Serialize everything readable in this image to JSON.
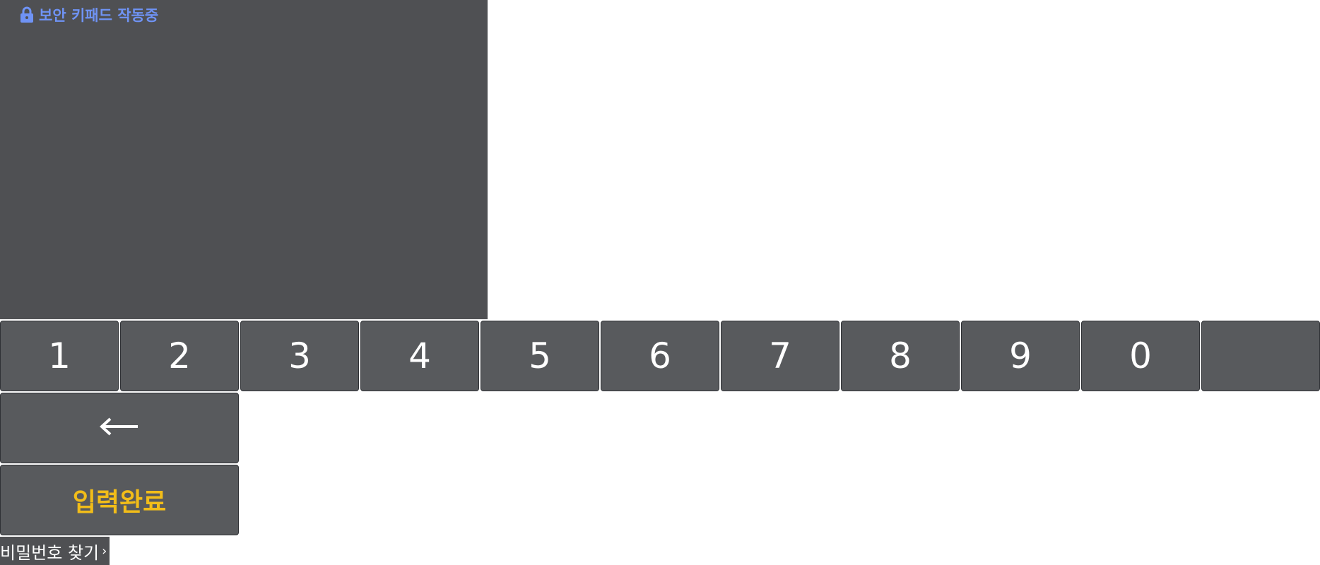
{
  "header": {
    "secure_label": "보안 키패드 작동중",
    "lock_icon": "lock-icon",
    "accent": "#6f93f5"
  },
  "keypad": {
    "digits": [
      "1",
      "2",
      "3",
      "4",
      "5",
      "6",
      "7",
      "8",
      "9",
      "0",
      ""
    ],
    "backspace_icon": "left-arrow-icon",
    "backspace_glyph": "←",
    "done_label": "입력완료",
    "done_color": "#f2bd19",
    "key_color": "#585a5d"
  },
  "footer": {
    "find_password_label": "비밀번호 찾기",
    "chevron": "›"
  }
}
